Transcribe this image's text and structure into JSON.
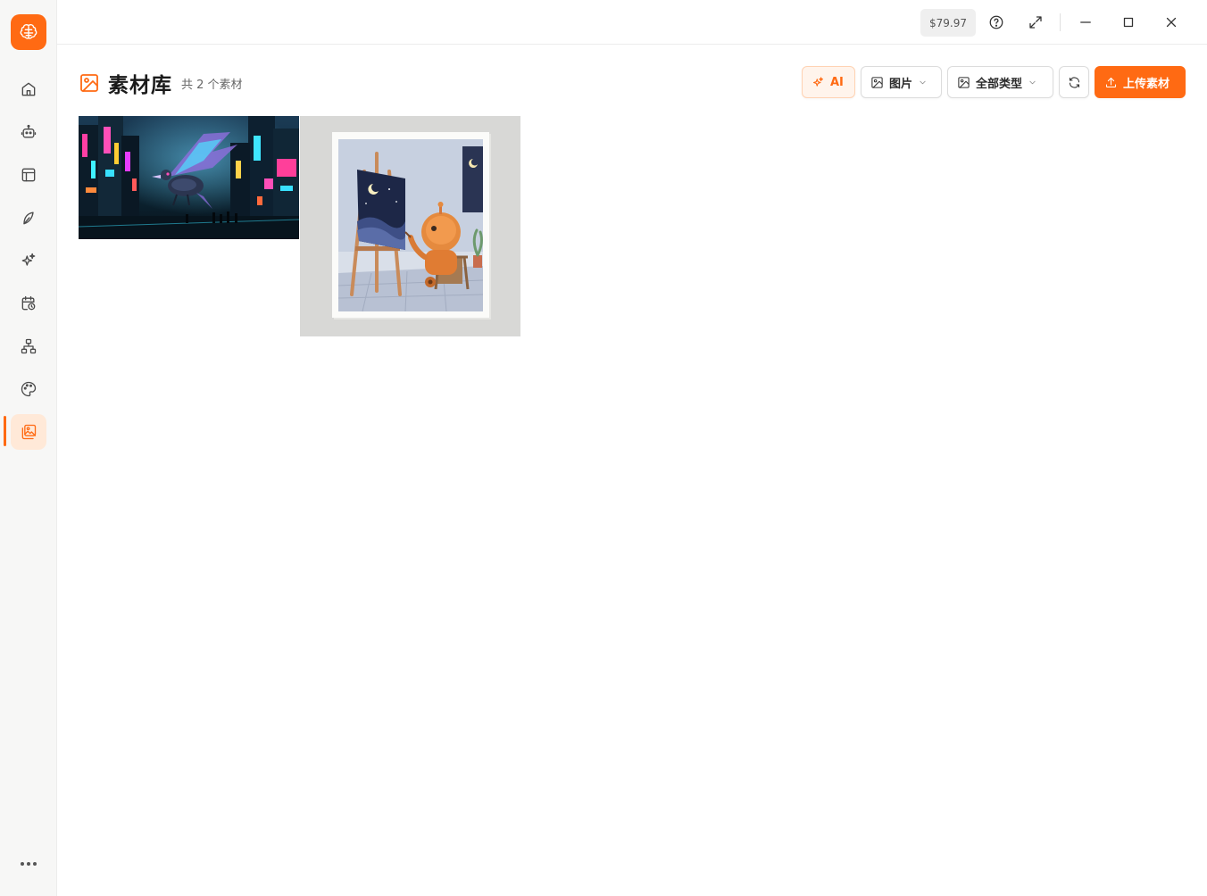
{
  "sidebar": {
    "logo": "brain-logo-icon",
    "items": [
      {
        "name": "home",
        "icon": "home-icon"
      },
      {
        "name": "robot",
        "icon": "robot-icon"
      },
      {
        "name": "layout",
        "icon": "layout-icon"
      },
      {
        "name": "leaf",
        "icon": "leaf-icon"
      },
      {
        "name": "sparkles",
        "icon": "sparkles-icon"
      },
      {
        "name": "calendar",
        "icon": "calendar-clock-icon"
      },
      {
        "name": "workflow",
        "icon": "sitemap-icon"
      },
      {
        "name": "palette",
        "icon": "palette-icon"
      },
      {
        "name": "assets",
        "icon": "images-icon",
        "active": true
      }
    ],
    "more": "more-icon"
  },
  "titlebar": {
    "balance": "$79.97",
    "icons": [
      "help-icon",
      "expand-icon",
      "minimize-icon",
      "maximize-icon",
      "close-icon"
    ]
  },
  "header": {
    "title": "素材库",
    "count": "共 2 个素材"
  },
  "toolbar": {
    "ai_label": "AI",
    "image_filter": "图片",
    "type_filter": "全部类型",
    "upload_label": "上传素材"
  },
  "colors": {
    "accent": "#ff6a13",
    "accent_soft": "#ffe9d8"
  },
  "assets": [
    {
      "kind": "image",
      "subject": "cyberpunk-city-mech-bird"
    },
    {
      "kind": "image",
      "subject": "robot-painting-night-sky"
    }
  ]
}
